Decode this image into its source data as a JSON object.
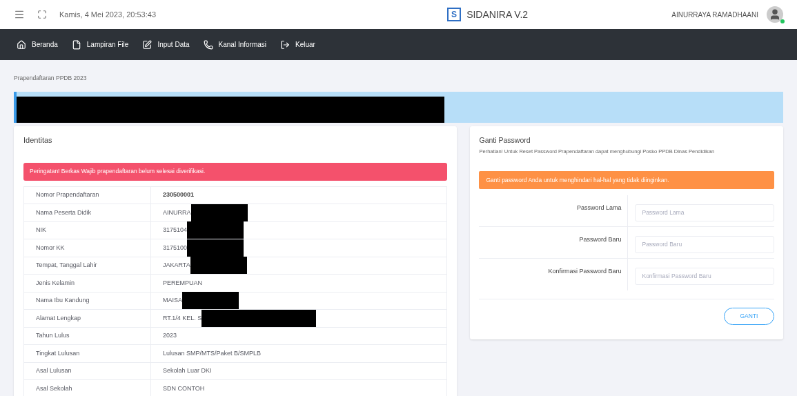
{
  "header": {
    "datetime": "Kamis, 4 Mei 2023, 20:53:43",
    "app_title": "SIDANIRA V.2",
    "logo_letter": "S",
    "user": {
      "name": "AINURRAYA RAMADHAANI",
      "online": true
    }
  },
  "nav": [
    {
      "kind": "home",
      "label": "Beranda"
    },
    {
      "kind": "file",
      "label": "Lampiran File"
    },
    {
      "kind": "edit",
      "label": "Input Data"
    },
    {
      "kind": "phone",
      "label": "Kanal Informasi"
    },
    {
      "kind": "logout",
      "label": "Keluar"
    }
  ],
  "breadcrumb": "Prapendaftaran PPDB 2023",
  "identity": {
    "title": "Identitas",
    "alert": "Peringatan! Berkas Wajib prapendaftaran belum selesai diverifikasi.",
    "rows": [
      {
        "label": "Nomor Prapendaftaran",
        "value": "230500001",
        "bold": true,
        "redacted": false
      },
      {
        "label": "Nama Peserta Didik",
        "value": "AINURRA",
        "bold": false,
        "redacted": true
      },
      {
        "label": "NIK",
        "value": "3175104",
        "bold": false,
        "redacted": true
      },
      {
        "label": "Nomor KK",
        "value": "3175100",
        "bold": false,
        "redacted": true
      },
      {
        "label": "Tempat, Tanggal Lahir",
        "value": "JAKARTA",
        "bold": false,
        "redacted": true
      },
      {
        "label": "Jenis Kelamin",
        "value": "PEREMPUAN",
        "bold": false,
        "redacted": false
      },
      {
        "label": "Nama Ibu Kandung",
        "value": "MAISA",
        "bold": false,
        "redacted": true
      },
      {
        "label": "Alamat Lengkap",
        "value": "RT.1/4 KEL. S",
        "bold": false,
        "redacted": true
      },
      {
        "label": "Tahun Lulus",
        "value": "2023",
        "bold": false,
        "redacted": false
      },
      {
        "label": "Tingkat Lulusan",
        "value": "Lulusan SMP/MTS/Paket B/SMPLB",
        "bold": false,
        "redacted": false
      },
      {
        "label": "Asal Lulusan",
        "value": "Sekolah Luar DKI",
        "bold": false,
        "redacted": false
      },
      {
        "label": "Asal Sekolah",
        "value": "SDN CONTOH",
        "bold": false,
        "redacted": false
      }
    ]
  },
  "password": {
    "title": "Ganti Password",
    "note": "Perhatian! Untuk Reset Password Prapendaftaran dapat menghubungi Posko PPDB Dinas Pendidikan",
    "alert": "Ganti password Anda untuk menghindari hal-hal yang tidak diinginkan.",
    "fields": [
      {
        "label": "Password Lama",
        "placeholder": "Password Lama"
      },
      {
        "label": "Password Baru",
        "placeholder": "Password Baru"
      },
      {
        "label": "Konfirmasi Password Baru",
        "placeholder": "Konfirmasi Password Baru"
      }
    ],
    "button": "GANTI"
  }
}
